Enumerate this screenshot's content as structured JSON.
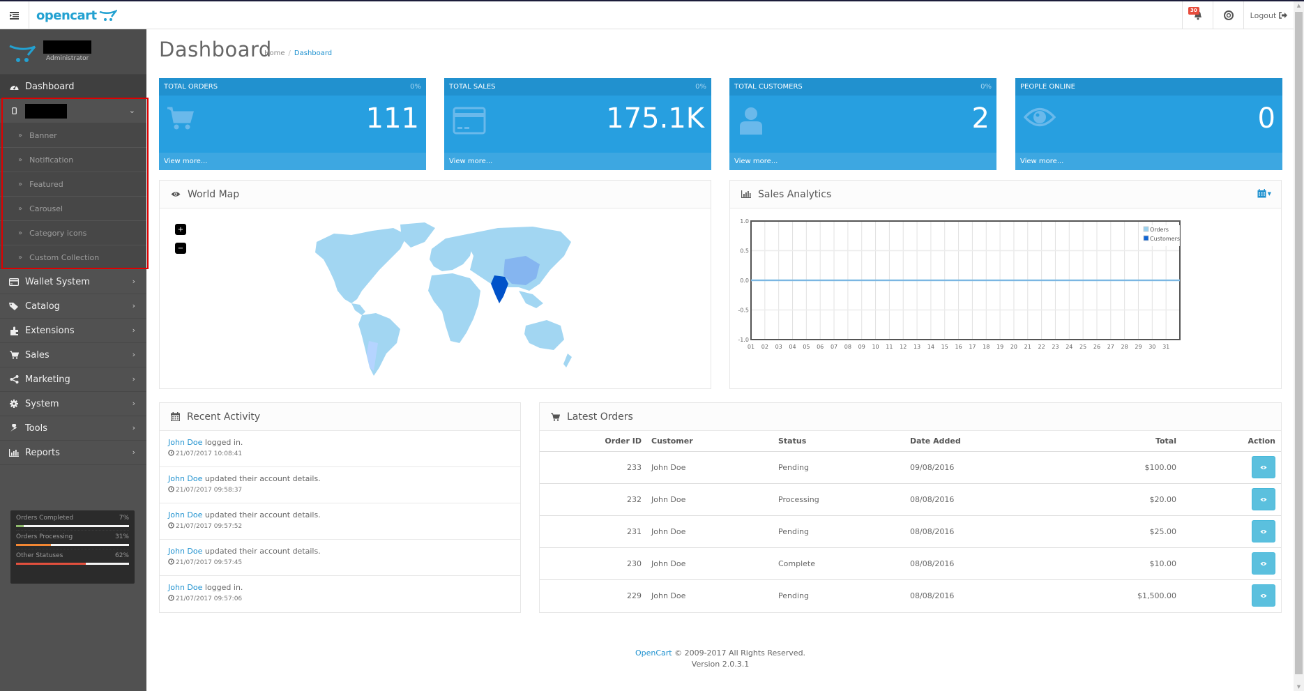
{
  "header": {
    "logo_text": "opencart",
    "notifications_count": "30",
    "logout_label": "Logout"
  },
  "sidebar": {
    "profile_role": "Administrator",
    "dashboard_label": "Dashboard",
    "custom_menu_label": "",
    "sub_items": [
      {
        "label": "Banner"
      },
      {
        "label": "Notification"
      },
      {
        "label": "Featured"
      },
      {
        "label": "Carousel"
      },
      {
        "label": "Category icons"
      },
      {
        "label": "Custom Collection"
      }
    ],
    "items": [
      {
        "label": "Wallet System",
        "icon": "credit-card-icon"
      },
      {
        "label": "Catalog",
        "icon": "tags-icon"
      },
      {
        "label": "Extensions",
        "icon": "puzzle-icon"
      },
      {
        "label": "Sales",
        "icon": "cart-icon"
      },
      {
        "label": "Marketing",
        "icon": "share-icon"
      },
      {
        "label": "System",
        "icon": "cog-icon"
      },
      {
        "label": "Tools",
        "icon": "wrench-icon"
      },
      {
        "label": "Reports",
        "icon": "bar-chart-icon"
      }
    ],
    "stats": [
      {
        "label": "Orders Completed",
        "value": "7%",
        "percent": 7,
        "color": "#8fbb6c"
      },
      {
        "label": "Orders Processing",
        "value": "31%",
        "percent": 31,
        "color": "#f38733"
      },
      {
        "label": "Other Statuses",
        "value": "62%",
        "percent": 62,
        "color": "#e3503e"
      }
    ]
  },
  "page": {
    "title": "Dashboard",
    "breadcrumb": {
      "home": "Home",
      "separator": "/",
      "current": "Dashboard"
    }
  },
  "tiles": [
    {
      "title": "TOTAL ORDERS",
      "percent": "0%",
      "value": "111",
      "footer": "View more...",
      "icon": "shopping-cart-icon"
    },
    {
      "title": "TOTAL SALES",
      "percent": "0%",
      "value": "175.1K",
      "footer": "View more...",
      "icon": "credit-card-icon"
    },
    {
      "title": "TOTAL CUSTOMERS",
      "percent": "0%",
      "value": "2",
      "footer": "View more...",
      "icon": "user-icon"
    },
    {
      "title": "PEOPLE ONLINE",
      "percent": "",
      "value": "0",
      "footer": "View more...",
      "icon": "eye-icon"
    }
  ],
  "world_map": {
    "title": "World Map",
    "zoom_in": "+",
    "zoom_out": "−",
    "highlighted": [
      {
        "country": "India",
        "color": "#0052c9"
      },
      {
        "country": "China",
        "color": "#85b5f0"
      },
      {
        "country": "Argentina",
        "color": "#b5d4ff"
      }
    ],
    "base_color": "#a2d6f2"
  },
  "sales_analytics": {
    "title": "Sales Analytics"
  },
  "chart_data": {
    "type": "line",
    "title": "Sales Analytics",
    "x": [
      "01",
      "02",
      "03",
      "04",
      "05",
      "06",
      "07",
      "08",
      "09",
      "10",
      "11",
      "12",
      "13",
      "14",
      "15",
      "16",
      "17",
      "18",
      "19",
      "20",
      "21",
      "22",
      "23",
      "24",
      "25",
      "26",
      "27",
      "28",
      "29",
      "30",
      "31"
    ],
    "series": [
      {
        "name": "Orders",
        "color": "#9bd1ef",
        "values": [
          0,
          0,
          0,
          0,
          0,
          0,
          0,
          0,
          0,
          0,
          0,
          0,
          0,
          0,
          0,
          0,
          0,
          0,
          0,
          0,
          0,
          0,
          0,
          0,
          0,
          0,
          0,
          0,
          0,
          0,
          0
        ]
      },
      {
        "name": "Customers",
        "color": "#1065d2",
        "values": [
          0,
          0,
          0,
          0,
          0,
          0,
          0,
          0,
          0,
          0,
          0,
          0,
          0,
          0,
          0,
          0,
          0,
          0,
          0,
          0,
          0,
          0,
          0,
          0,
          0,
          0,
          0,
          0,
          0,
          0,
          0
        ]
      }
    ],
    "yticks": [
      "1.0",
      "0.5",
      "0.0",
      "-0.5",
      "-1.0"
    ],
    "ylim": [
      -1,
      1
    ],
    "grid": true,
    "legend": "top-right",
    "xlabel": "",
    "ylabel": ""
  },
  "recent_activity": {
    "title": "Recent Activity",
    "items": [
      {
        "who": "John Doe",
        "action": " logged in.",
        "time": "21/07/2017 10:08:41"
      },
      {
        "who": "John Doe",
        "action": " updated their account details.",
        "time": "21/07/2017 09:58:37"
      },
      {
        "who": "John Doe",
        "action": " updated their account details.",
        "time": "21/07/2017 09:57:52"
      },
      {
        "who": "John Doe",
        "action": " updated their account details.",
        "time": "21/07/2017 09:57:45"
      },
      {
        "who": "John Doe",
        "action": " logged in.",
        "time": "21/07/2017 09:57:06"
      }
    ]
  },
  "latest_orders": {
    "title": "Latest Orders",
    "columns": [
      "Order ID",
      "Customer",
      "Status",
      "Date Added",
      "Total",
      "Action"
    ],
    "rows": [
      {
        "order_id": "233",
        "customer": "John Doe",
        "status": "Pending",
        "date": "09/08/2016",
        "total": "$100.00"
      },
      {
        "order_id": "232",
        "customer": "John Doe",
        "status": "Processing",
        "date": "08/08/2016",
        "total": "$20.00"
      },
      {
        "order_id": "231",
        "customer": "John Doe",
        "status": "Pending",
        "date": "08/08/2016",
        "total": "$25.00"
      },
      {
        "order_id": "230",
        "customer": "John Doe",
        "status": "Complete",
        "date": "08/08/2016",
        "total": "$10.00"
      },
      {
        "order_id": "229",
        "customer": "John Doe",
        "status": "Pending",
        "date": "08/08/2016",
        "total": "$1,500.00"
      }
    ]
  },
  "footer": {
    "brand": "OpenCart",
    "copyright": " © 2009-2017 All Rights Reserved.",
    "version": "Version 2.0.3.1"
  }
}
